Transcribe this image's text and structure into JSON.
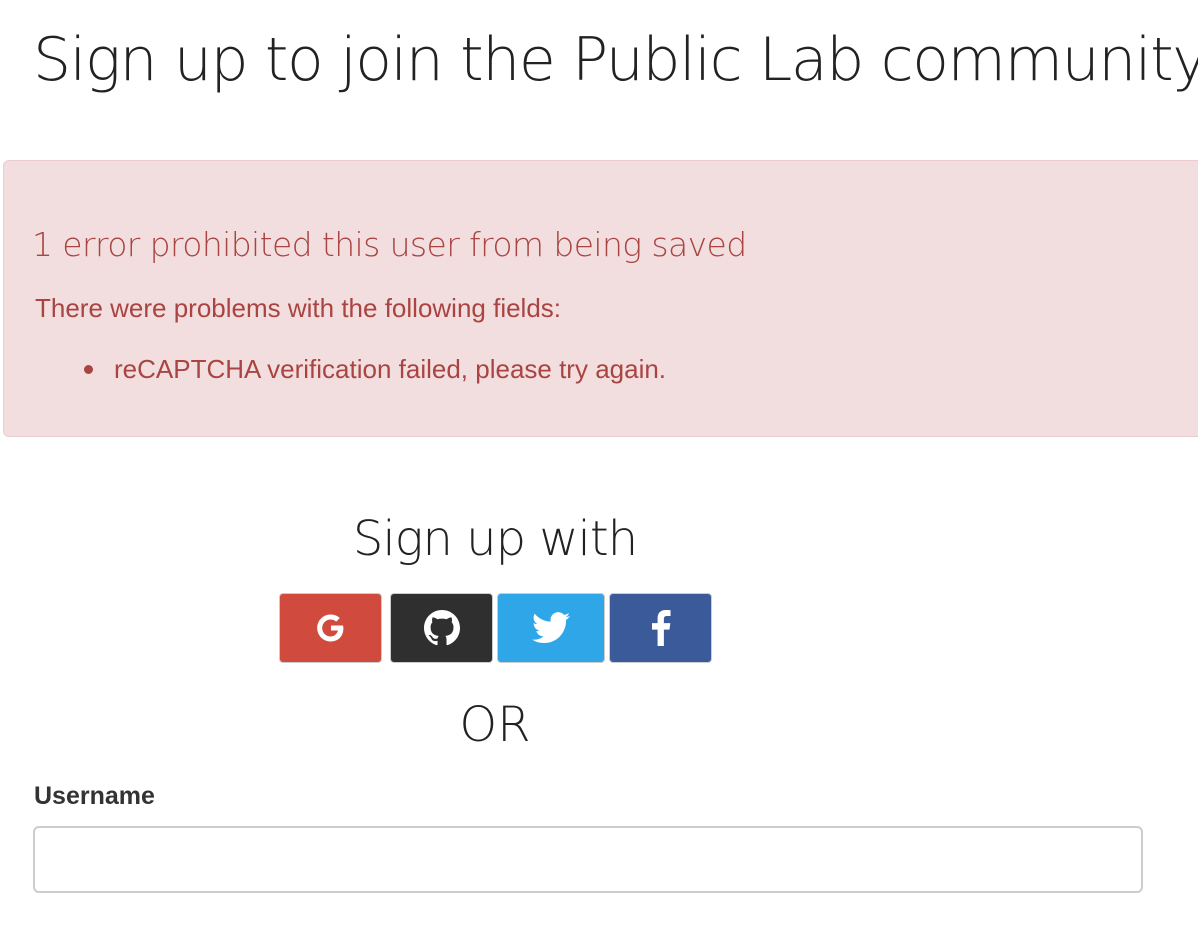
{
  "page": {
    "title": "Sign up to join the Public Lab community"
  },
  "alert": {
    "heading": "1 error prohibited this user from being saved",
    "subheading": "There were problems with the following fields:",
    "errors": [
      "reCAPTCHA verification failed, please try again."
    ],
    "background_color": "#f2dede",
    "text_color": "#a94442"
  },
  "social": {
    "heading": "Sign up with",
    "providers": [
      {
        "name": "Google",
        "icon": "google-icon",
        "color": "#d04b3d"
      },
      {
        "name": "GitHub",
        "icon": "github-icon",
        "color": "#2f2f2f"
      },
      {
        "name": "Twitter",
        "icon": "twitter-icon",
        "color": "#2ea6e8"
      },
      {
        "name": "Facebook",
        "icon": "facebook-icon",
        "color": "#3b5a99"
      }
    ]
  },
  "divider": {
    "text": "OR"
  },
  "form": {
    "username_label": "Username",
    "username_value": "",
    "username_placeholder": ""
  }
}
